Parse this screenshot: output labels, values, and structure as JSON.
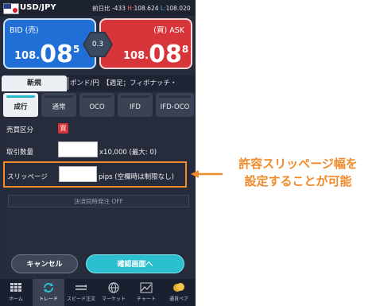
{
  "header": {
    "pair": "USD/JPY",
    "change_label": "前日比 -433",
    "high_prefix": "H:",
    "high": "108.624",
    "low_prefix": "L:",
    "low": "108.020"
  },
  "quote": {
    "bid_label": "BID (売)",
    "bid_small": "108.",
    "bid_big": "08",
    "bid_pip": "5",
    "ask_label": "(買) ASK",
    "ask_small": "108.",
    "ask_big": "08",
    "ask_pip": "8",
    "spread": "0.3"
  },
  "top_tabs": {
    "active": "新規",
    "other": "ポンド/円　【週足；フィボナッチ・"
  },
  "order_tabs": [
    "成行",
    "通常",
    "OCO",
    "IFD",
    "IFD-OCO"
  ],
  "form": {
    "side_label": "売買区分",
    "side_value": "買",
    "qty_label": "取引数量",
    "qty_unit": "x10,000 (最大: 0)",
    "slip_label": "スリッページ",
    "slip_unit": "pips (空欄時は制限なし)",
    "settle": "決済同時発注 OFF"
  },
  "buttons": {
    "cancel": "キャンセル",
    "confirm": "確認画面へ"
  },
  "nav": [
    {
      "label": "ホーム",
      "icon": "home-grid-icon"
    },
    {
      "label": "トレード",
      "icon": "trade-arrows-icon"
    },
    {
      "label": "スピード注文",
      "icon": "speed-icon"
    },
    {
      "label": "マーケット",
      "icon": "globe-icon"
    },
    {
      "label": "チャート",
      "icon": "chart-icon"
    },
    {
      "label": "通貨ペア",
      "icon": "currency-pair-icon"
    }
  ],
  "callout": {
    "line1": "許容スリッページ幅を",
    "line2": "設定することが可能"
  },
  "colors": {
    "bid": "#1f6fd6",
    "ask": "#d8353a",
    "accent": "#2bbfcf",
    "highlight": "#f08a2a"
  }
}
